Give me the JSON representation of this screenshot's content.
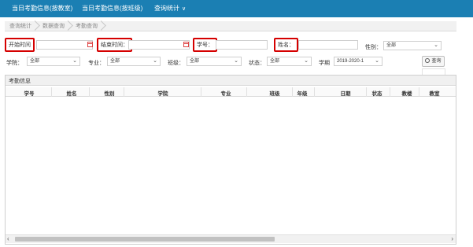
{
  "nav": {
    "items": [
      "当日考勤信息(按教室)",
      "当日考勤信息(按班级)",
      "查询统计"
    ],
    "dropdown_chevron": "chevron-down-icon"
  },
  "breadcrumb": [
    "查询统计",
    "数据查询",
    "考勤查询"
  ],
  "filters": {
    "start_time_label": "开始时间",
    "end_time_label": "结束时间：",
    "student_id_label": "学号：",
    "name_label": "姓名：",
    "gender_label": "性别：",
    "gender_value": "全部",
    "college_label": "学院：",
    "college_value": "全部",
    "major_label": "专业：",
    "major_value": "全部",
    "class_label": "班级：",
    "class_value": "全部",
    "status_label": "状态：",
    "status_value": "全部",
    "semester_label": "学期",
    "semester_value": "2019-2020-1",
    "query_button": "查询"
  },
  "panel": {
    "title": "考勤信息",
    "columns": [
      "学号",
      "姓名",
      "性别",
      "学院",
      "专业",
      "班级",
      "年级",
      "日期",
      "状态",
      "教楼",
      "教室"
    ]
  },
  "colors": {
    "nav_bg": "#1b7fb3",
    "highlight_border": "#d50000"
  }
}
